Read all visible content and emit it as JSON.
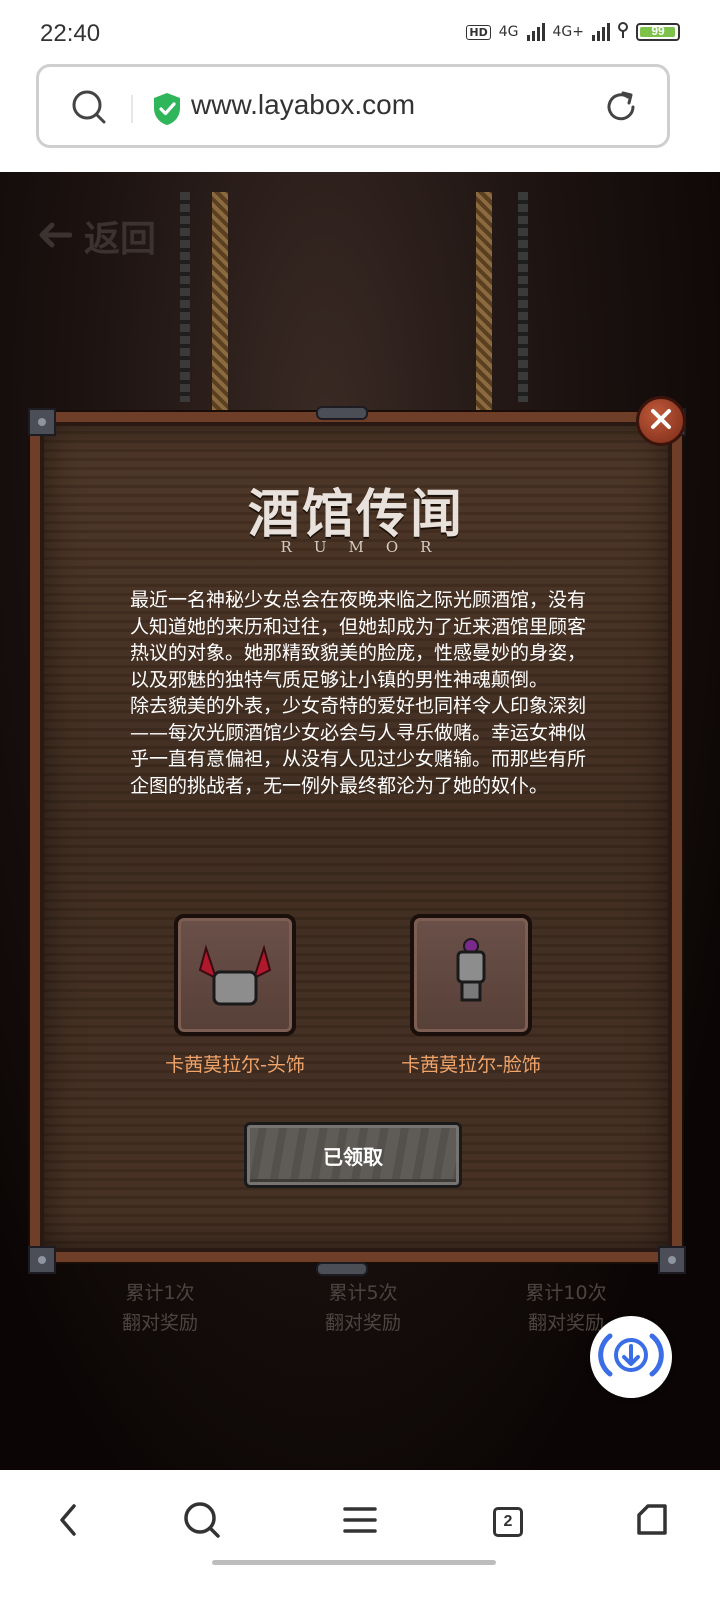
{
  "status_bar": {
    "time": "22:40",
    "hd_label": "HD",
    "network_1": "4G",
    "network_2": "4G+",
    "battery": "99",
    "battery_level": 0.99
  },
  "url_bar": {
    "url": "www.layabox.com",
    "secure": true
  },
  "game": {
    "back_label": "返回",
    "milestones": [
      {
        "line1": "累计1次",
        "line2": "翻对奖励"
      },
      {
        "line1": "累计5次",
        "line2": "翻对奖励"
      },
      {
        "line1": "累计10次",
        "line2": "翻对奖励"
      }
    ]
  },
  "dialog": {
    "title": "酒馆传闻",
    "subtitle": "RUMOR",
    "paragraph1": "最近一名神秘少女总会在夜晚来临之际光顾酒馆，没有人知道她的来历和过往，但她却成为了近来酒馆里顾客热议的对象。她那精致貌美的脸庞，性感曼妙的身姿，以及邪魅的独特气质足够让小镇的男性神魂颠倒。",
    "paragraph2": "除去貌美的外表，少女奇特的爱好也同样令人印象深刻——每次光顾酒馆少女必会与人寻乐做赌。幸运女神似乎一直有意偏袒，从没有人见过少女赌输。而那些有所企图的挑战者，无一例外最终都沦为了她的奴仆。",
    "rewards": [
      {
        "name": "卡茜莫拉尔-头饰",
        "icon": "horned-helmet-icon"
      },
      {
        "name": "卡茜莫拉尔-脸饰",
        "icon": "face-mask-icon"
      }
    ],
    "claim_label": "已领取",
    "accent_color": "#f0a46a"
  },
  "bottom_nav": {
    "tab_count": "2"
  }
}
